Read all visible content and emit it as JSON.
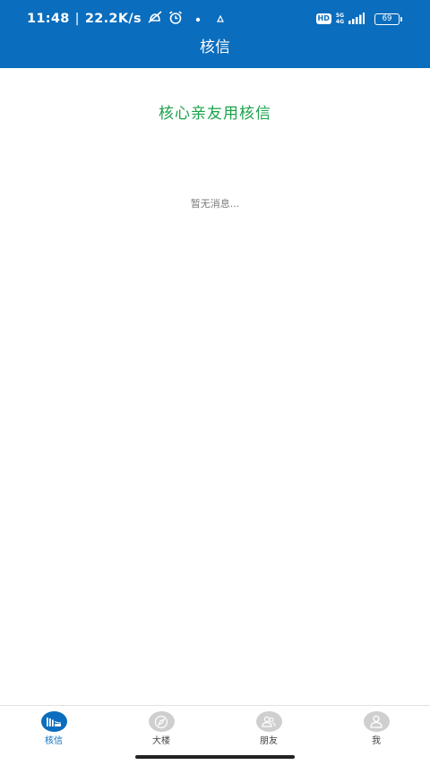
{
  "status_bar": {
    "time": "11:48",
    "speed": "22.2K/s",
    "network_top": "5G",
    "network_bottom": "4G",
    "hd": "HD",
    "battery": "69"
  },
  "header": {
    "title": "核信"
  },
  "main": {
    "slogan": "核心亲友用核信",
    "empty_message": "暂无消息..."
  },
  "tabs": [
    {
      "label": "核信",
      "icon": "chat-wave-icon",
      "active": true
    },
    {
      "label": "大楼",
      "icon": "compass-icon",
      "active": false
    },
    {
      "label": "朋友",
      "icon": "friends-icon",
      "active": false
    },
    {
      "label": "我",
      "icon": "person-icon",
      "active": false
    }
  ],
  "colors": {
    "brand": "#0a6dbd",
    "slogan": "#1aa34a",
    "inactive_icon": "#cfcfcf"
  }
}
